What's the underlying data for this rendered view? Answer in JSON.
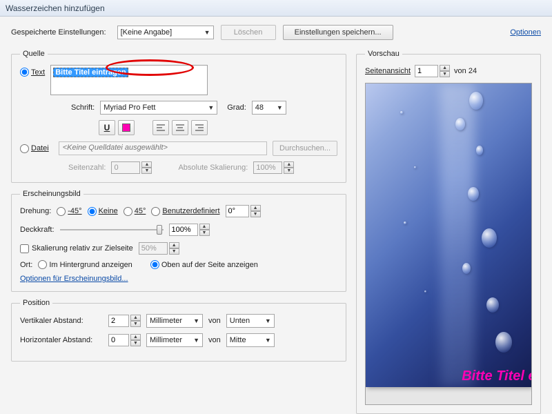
{
  "window": {
    "title": "Wasserzeichen hinzufügen"
  },
  "toprow": {
    "saved_label": "Gespeicherte Einstellungen:",
    "saved_value": "[Keine Angabe]",
    "delete": "Löschen",
    "save_settings": "Einstellungen speichern...",
    "options": "Optionen"
  },
  "quelle": {
    "legend": "Quelle",
    "text_radio": "Text",
    "text_value": "Bitte Titel eintragen",
    "font_label": "Schrift:",
    "font_value": "Myriad Pro Fett",
    "size_label": "Grad:",
    "size_value": "48",
    "file_radio": "Datei",
    "file_value": "<Keine Quelldatei ausgewählt>",
    "browse": "Durchsuchen...",
    "pageno_label": "Seitenzahl:",
    "pageno_value": "0",
    "absscale_label": "Absolute Skalierung:",
    "absscale_value": "100%"
  },
  "erscheinung": {
    "legend": "Erscheinungsbild",
    "rotation_label": "Drehung:",
    "rot_m45": "-45°",
    "rot_none": "Keine",
    "rot_p45": "45°",
    "rot_custom": "Benutzerdefiniert",
    "rot_custom_value": "0°",
    "opacity_label": "Deckkraft:",
    "opacity_value": "100%",
    "scale_rel": "Skalierung relativ zur Zielseite",
    "scale_rel_value": "50%",
    "loc_label": "Ort:",
    "loc_bg": "Im Hintergrund anzeigen",
    "loc_fg": "Oben auf der Seite anzeigen",
    "appearance_opts": "Optionen für Erscheinungsbild..."
  },
  "position": {
    "legend": "Position",
    "vdist_label": "Vertikaler Abstand:",
    "vdist_value": "2",
    "vdist_unit": "Millimeter",
    "vdist_from_label": "von",
    "vdist_from": "Unten",
    "hdist_label": "Horizontaler Abstand:",
    "hdist_value": "0",
    "hdist_unit": "Millimeter",
    "hdist_from_label": "von",
    "hdist_from": "Mitte"
  },
  "vorschau": {
    "legend": "Vorschau",
    "pageview_label": "Seitenansicht",
    "pageview_value": "1",
    "pageview_total": "von 24",
    "watermark_text": "Bitte Titel eintrage",
    "watermark_color": "#ff00b3"
  }
}
